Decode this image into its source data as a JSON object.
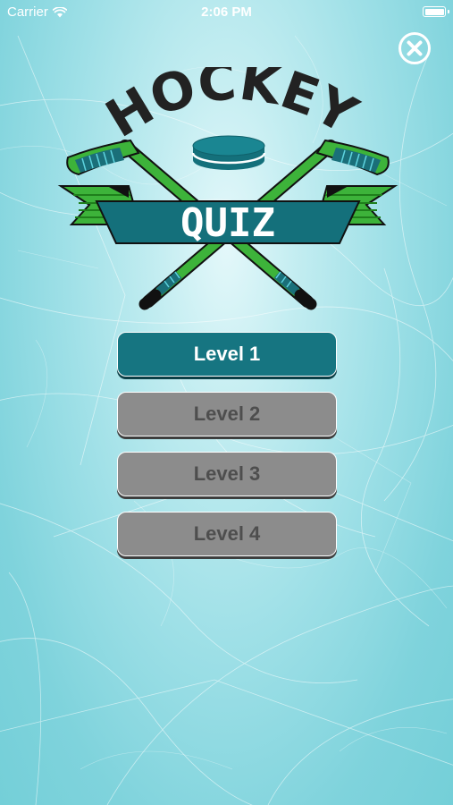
{
  "status_bar": {
    "carrier": "Carrier",
    "time": "2:06 PM",
    "wifi_icon": "wifi-icon",
    "battery_icon": "battery-full-icon"
  },
  "close_button": {
    "icon": "close-icon"
  },
  "logo": {
    "title": "HOCKEY",
    "subtitle": "QUIZ",
    "icons": [
      "hockey-stick-icon",
      "hockey-puck-icon",
      "ribbon-banner"
    ]
  },
  "levels": [
    {
      "label": "Level 1",
      "state": "unlocked"
    },
    {
      "label": "Level 2",
      "state": "locked"
    },
    {
      "label": "Level 3",
      "state": "locked"
    },
    {
      "label": "Level 4",
      "state": "locked"
    }
  ],
  "colors": {
    "teal": "#167581",
    "gray": "#8c8c8c",
    "green": "#3db33a",
    "ice": "#7fd3dc"
  }
}
